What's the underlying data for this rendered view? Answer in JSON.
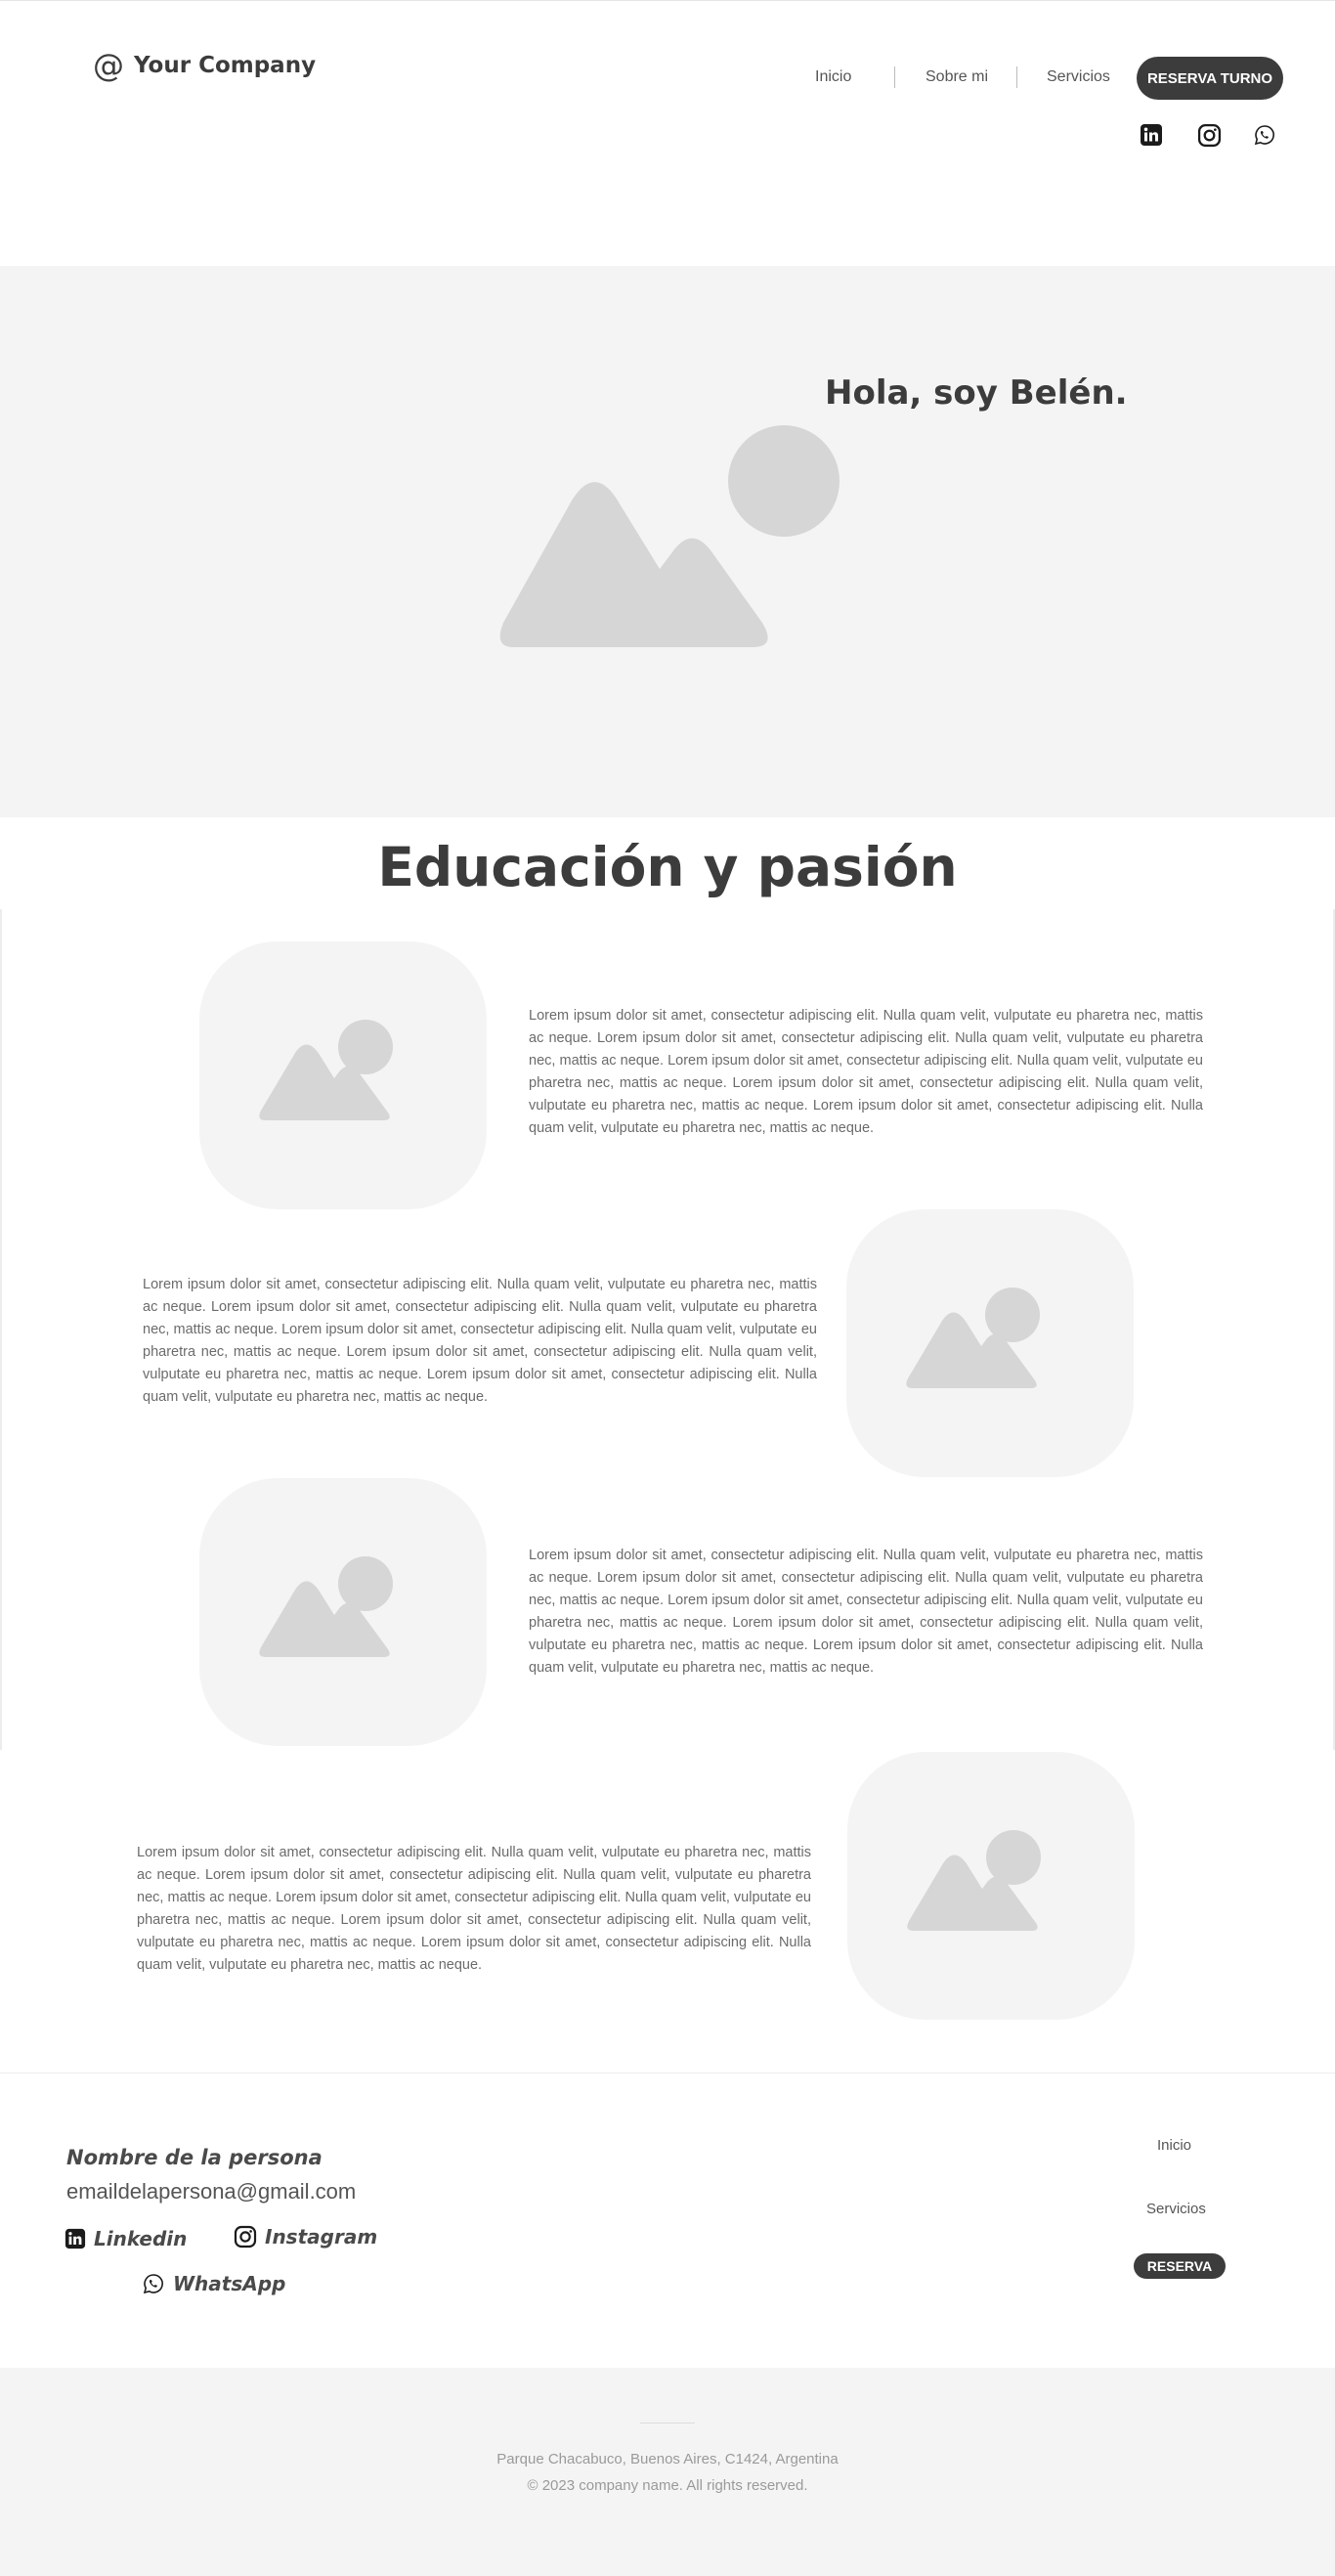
{
  "header": {
    "logo_icon": "@",
    "logo_text": "Your Company",
    "nav": [
      "Inicio",
      "Sobre mi",
      "Servicios"
    ],
    "cta": "RESERVA TURNO",
    "social_icons": [
      "linkedin-icon",
      "instagram-icon",
      "whatsapp-icon"
    ]
  },
  "hero": {
    "title": "Hola, soy Belén."
  },
  "section": {
    "title": "Educación y pasión",
    "lorem": "Lorem ipsum dolor sit amet, consectetur adipiscing elit. Nulla quam velit, vulputate eu pharetra nec, mattis ac neque. Lorem ipsum dolor sit amet, consectetur adipiscing elit. Nulla quam velit, vulputate eu pharetra nec, mattis ac neque. Lorem ipsum dolor sit amet, consectetur adipiscing elit. Nulla quam velit, vulputate eu pharetra nec, mattis ac neque. Lorem ipsum dolor sit amet, consectetur adipiscing elit. Nulla quam velit, vulputate eu pharetra nec, mattis ac neque. Lorem ipsum dolor sit amet, consectetur adipiscing elit. Nulla quam velit, vulputate eu pharetra nec, mattis ac neque."
  },
  "footer": {
    "name": "Nombre de la persona",
    "email": "emaildelapersona@gmail.com",
    "linkedin": "Linkedin",
    "instagram": "Instagram",
    "whatsapp": "WhatsApp",
    "nav_inicio": "Inicio",
    "nav_servicios": "Servicios",
    "cta": "RESERVA",
    "address": "Parque Chacabuco, Buenos Aires, C1424, Argentina",
    "copyright": "© 2023 company name.  All rights reserved."
  },
  "colors": {
    "dark": "#3c3c3c",
    "light_bg": "#f5f4f4",
    "placeholder": "#d6d6d6"
  }
}
